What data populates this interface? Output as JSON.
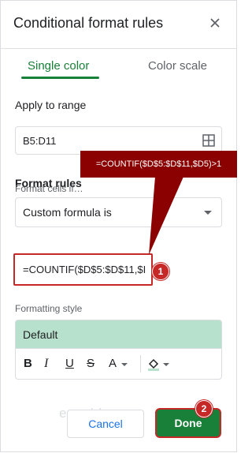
{
  "header": {
    "title": "Conditional format rules",
    "close_icon": "close-icon"
  },
  "tabs": [
    {
      "label": "Single color",
      "active": true
    },
    {
      "label": "Color scale",
      "active": false
    }
  ],
  "apply_to_range": {
    "label": "Apply to range",
    "value": "B5:D11",
    "icon": "grid-icon"
  },
  "format_rules": {
    "label": "Format rules",
    "condition_label": "Format cells if…",
    "condition_value": "Custom formula is",
    "formula_value": "=COUNTIF($D$5:$D$11,$I"
  },
  "callout": {
    "text": "=COUNTIF($D$5:$D$11,$D5)>1",
    "color": "#8b0000"
  },
  "badges": {
    "one": "1",
    "two": "2"
  },
  "formatting_style": {
    "label": "Formatting style",
    "preview_text": "Default",
    "preview_bg": "#b7e1cd",
    "toolbar": {
      "bold": "B",
      "italic": "I",
      "underline": "U",
      "strike": "S",
      "text_color": "A"
    }
  },
  "buttons": {
    "cancel": "Cancel",
    "done": "Done"
  },
  "watermark": "exceldemy",
  "colors": {
    "accent": "#188038",
    "highlight": "#c62828"
  }
}
